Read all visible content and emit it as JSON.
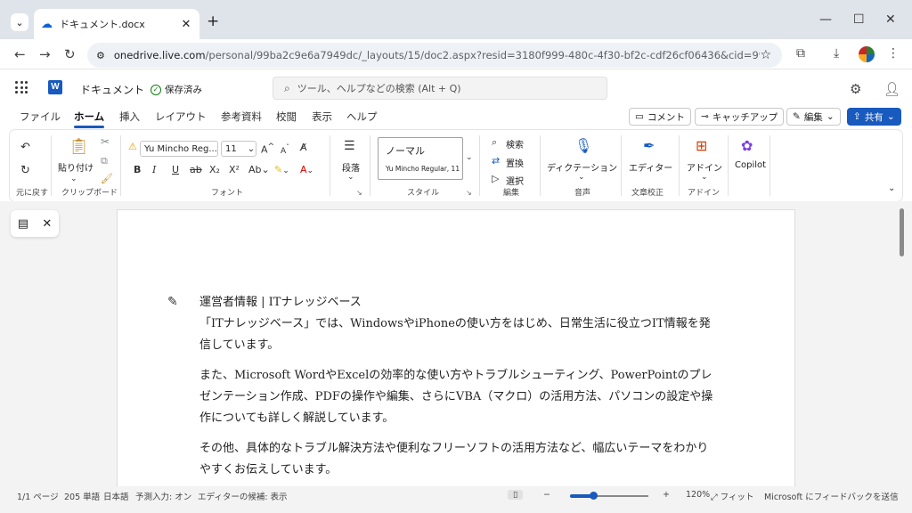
{
  "browser": {
    "tab_title": "ドキュメント.docx",
    "url_host": "onedrive.live.com",
    "url_path": "/personal/99ba2c9e6a7949dc/_layouts/15/doc2.aspx?resid=3180f999-480c-4f30-bf2c-cdf26cf06436&cid=99ba2c9e6a7949d..."
  },
  "word": {
    "doc_name": "ドキュメント",
    "save_status": "保存済み",
    "search_placeholder": "ツール、ヘルプなどの検索 (Alt + Q)"
  },
  "menu": {
    "tabs": [
      "ファイル",
      "ホーム",
      "挿入",
      "レイアウト",
      "参考資料",
      "校閲",
      "表示",
      "ヘルプ"
    ],
    "comment": "コメント",
    "catchup": "キャッチアップ",
    "edit": "編集",
    "share": "共有"
  },
  "ribbon": {
    "undo_group": "元に戻す",
    "paste": "貼り付け",
    "clipboard": "クリップボード",
    "font_name": "Yu Mincho Reg...",
    "font_size": "11",
    "font_group": "フォント",
    "paragraph": "段落",
    "style_name": "ノーマル",
    "style_font": "Yu Mincho Regular, 11",
    "style_group": "スタイル",
    "find": "検索",
    "replace": "置換",
    "select": "選択",
    "edit_group": "編集",
    "dictation": "ディクテーション",
    "voice_group": "音声",
    "editor": "エディター",
    "proofing_group": "文章校正",
    "addins": "アドイン",
    "addins_group": "アドイン",
    "copilot": "Copilot"
  },
  "document": {
    "heading": "運営者情報 | ITナレッジベース",
    "p1": "「ITナレッジベース」では、WindowsやiPhoneの使い方をはじめ、日常生活に役立つIT情報を発信しています。",
    "p2": "また、Microsoft WordやExcelの効率的な使い方やトラブルシューティング、PowerPointのプレゼンテーション作成、PDFの操作や編集、さらにVBA（マクロ）の活用方法、パソコンの設定や操作についても詳しく解説しています。",
    "p3": "その他、具体的なトラブル解決方法や便利なフリーソフトの活用方法など、幅広いテーマをわかりやすくお伝えしています。"
  },
  "status": {
    "page": "1/1 ページ",
    "words": "205 単語",
    "lang": "日本語",
    "predict": "予測入力: オン",
    "editor": "エディターの候補: 表示",
    "zoom": "120%",
    "zoom_level": 0.3,
    "fit": "フィット",
    "feedback": "Microsoft にフィードバックを送信"
  }
}
